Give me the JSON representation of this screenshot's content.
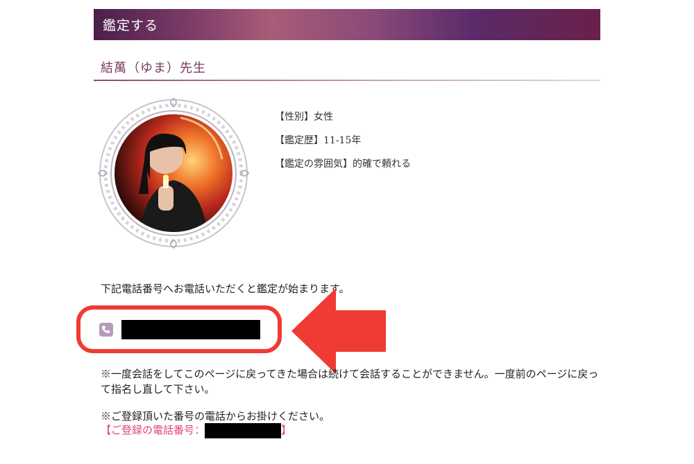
{
  "header": {
    "title": "鑑定する"
  },
  "teacher": {
    "name": "結萬（ゆま）先生",
    "portrait_alt": "teacher-portrait"
  },
  "profile": [
    {
      "label": "【性別】",
      "value": "女性"
    },
    {
      "label": "【鑑定歴】",
      "value": "11-15年"
    },
    {
      "label": "【鑑定の雰囲気】",
      "value": "的確で頼れる"
    }
  ],
  "instruction": "下記電話番号へお電話いただくと鑑定が始まります。",
  "phone": {
    "icon": "phone-icon",
    "number": "",
    "highlight_color": "#ef3b33"
  },
  "notices": {
    "first": "※一度会話をしてこのページに戻ってきた場合は続けて会話することができません。一度前のページに戻って指名し直して下さい。",
    "second": "※ご登録頂いた番号の電話からお掛けください。",
    "registered_label": "【ご登録の電話番号：",
    "registered_value": "",
    "registered_close": "】"
  },
  "colors": {
    "accent": "#7a3a5e",
    "registered": "#e0457c",
    "arrow": "#ef3b33"
  }
}
